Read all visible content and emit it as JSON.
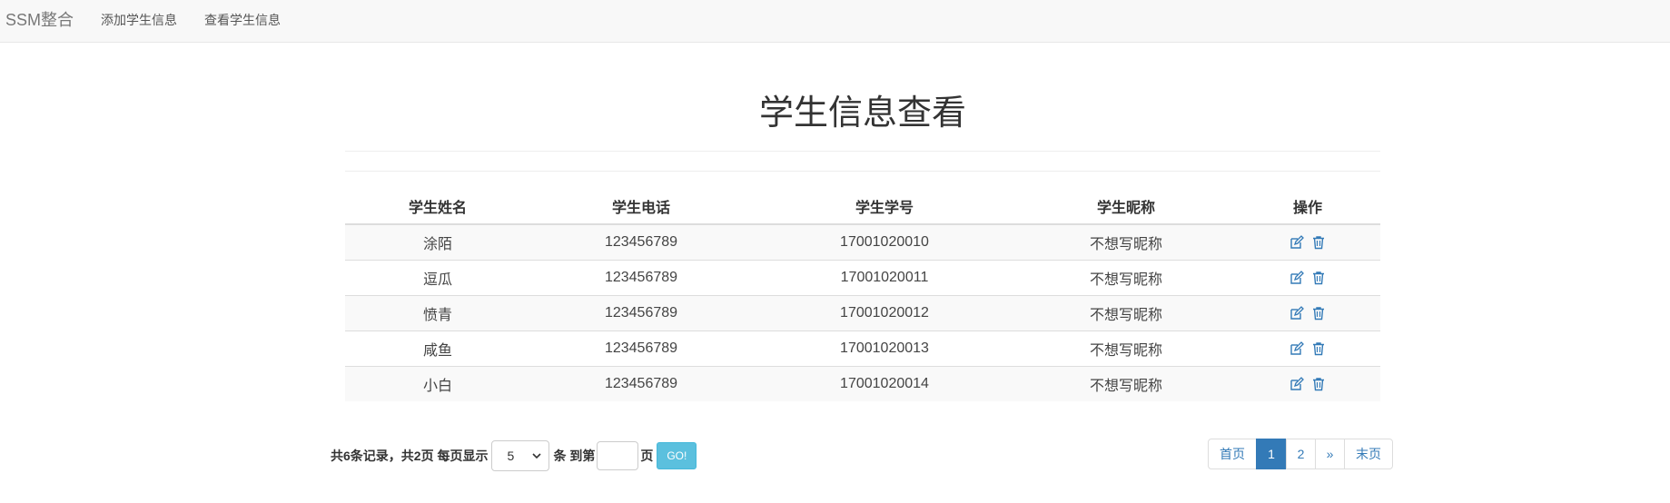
{
  "navbar": {
    "brand": "SSM整合",
    "links": [
      "添加学生信息",
      "查看学生信息"
    ]
  },
  "header": {
    "title": "学生信息查看"
  },
  "table": {
    "columns": [
      "学生姓名",
      "学生电话",
      "学生学号",
      "学生昵称",
      "操作"
    ],
    "rows": [
      {
        "name": "涂陌",
        "phone": "123456789",
        "id": "17001020010",
        "nickname": "不想写昵称"
      },
      {
        "name": "逗瓜",
        "phone": "123456789",
        "id": "17001020011",
        "nickname": "不想写昵称"
      },
      {
        "name": "愤青",
        "phone": "123456789",
        "id": "17001020012",
        "nickname": "不想写昵称"
      },
      {
        "name": "咸鱼",
        "phone": "123456789",
        "id": "17001020013",
        "nickname": "不想写昵称"
      },
      {
        "name": "小白",
        "phone": "123456789",
        "id": "17001020014",
        "nickname": "不想写昵称"
      }
    ],
    "actions": {
      "edit_icon": "edit-icon",
      "delete_icon": "trash-icon"
    }
  },
  "footer": {
    "summary": "共6条记录，共2页 每页显示",
    "page_size": "5",
    "rows_unit": "条 到第",
    "page_input": "",
    "page_unit": "页",
    "go_label": "GO!"
  },
  "pagination": {
    "first": "首页",
    "pages": [
      "1",
      "2"
    ],
    "next": "»",
    "last": "末页",
    "active_page": "1"
  },
  "colors": {
    "link": "#337ab7",
    "go_button": "#5bc0de",
    "navbar_bg": "#f8f8f8"
  }
}
